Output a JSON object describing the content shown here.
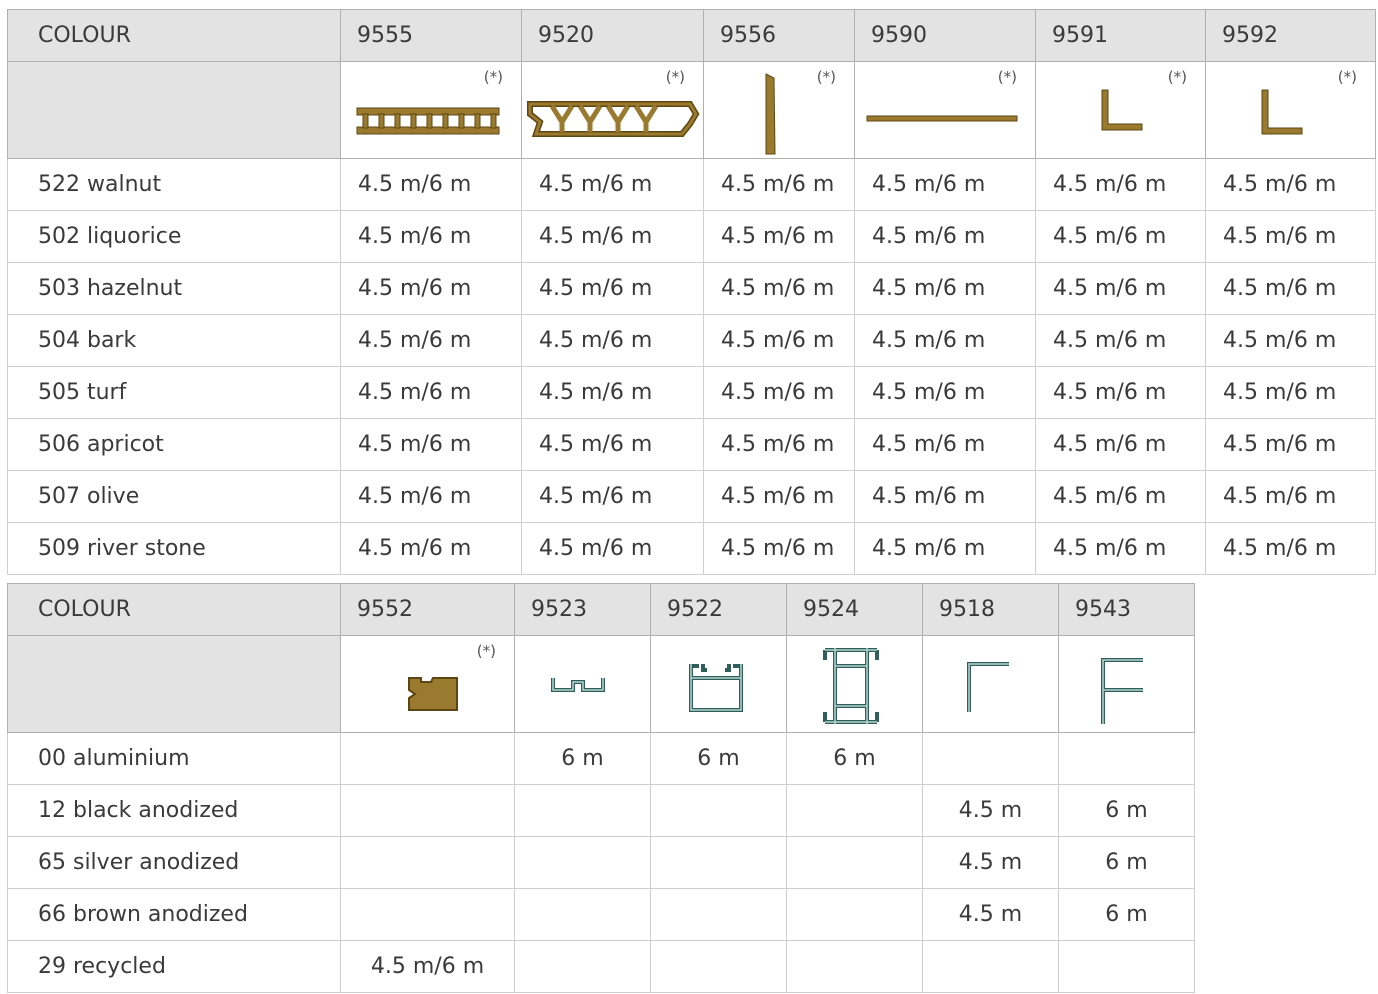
{
  "table1": {
    "header": [
      "COLOUR",
      "9555",
      "9520",
      "9556",
      "9590",
      "9591",
      "9592"
    ],
    "marker": "(*)",
    "profile_icons": [
      "deck-board-profile-icon",
      "deck-board-grooved-profile-icon",
      "vertical-strip-profile-icon",
      "flat-strip-profile-icon",
      "angle-profile-icon",
      "angle-profile-icon"
    ],
    "rows": [
      {
        "label": "522  walnut",
        "cells": [
          "4.5 m/6 m",
          "4.5 m/6 m",
          "4.5 m/6 m",
          "4.5 m/6 m",
          "4.5 m/6 m",
          "4.5 m/6 m"
        ]
      },
      {
        "label": "502  liquorice",
        "cells": [
          "4.5 m/6 m",
          "4.5 m/6 m",
          "4.5 m/6 m",
          "4.5 m/6 m",
          "4.5 m/6 m",
          "4.5 m/6 m"
        ]
      },
      {
        "label": "503  hazelnut",
        "cells": [
          "4.5 m/6 m",
          "4.5 m/6 m",
          "4.5 m/6 m",
          "4.5 m/6 m",
          "4.5 m/6 m",
          "4.5 m/6 m"
        ]
      },
      {
        "label": "504  bark",
        "cells": [
          "4.5 m/6 m",
          "4.5 m/6 m",
          "4.5 m/6 m",
          "4.5 m/6 m",
          "4.5 m/6 m",
          "4.5 m/6 m"
        ]
      },
      {
        "label": "505  turf",
        "cells": [
          "4.5 m/6 m",
          "4.5 m/6 m",
          "4.5 m/6 m",
          "4.5 m/6 m",
          "4.5 m/6 m",
          "4.5 m/6 m"
        ]
      },
      {
        "label": "506  apricot",
        "cells": [
          "4.5 m/6 m",
          "4.5 m/6 m",
          "4.5 m/6 m",
          "4.5 m/6 m",
          "4.5 m/6 m",
          "4.5 m/6 m"
        ]
      },
      {
        "label": "507  olive",
        "cells": [
          "4.5 m/6 m",
          "4.5 m/6 m",
          "4.5 m/6 m",
          "4.5 m/6 m",
          "4.5 m/6 m",
          "4.5 m/6 m"
        ]
      },
      {
        "label": "509  river stone",
        "cells": [
          "4.5 m/6 m",
          "4.5 m/6 m",
          "4.5 m/6 m",
          "4.5 m/6 m",
          "4.5 m/6 m",
          "4.5 m/6 m"
        ]
      }
    ]
  },
  "table2": {
    "header": [
      "COLOUR",
      "9552",
      "9523",
      "9522",
      "9524",
      "9518",
      "9543"
    ],
    "marker": "(*)",
    "profile_icons": [
      "end-cap-profile-icon",
      "channel-profile-icon",
      "box-profile-icon",
      "joist-profile-icon",
      "angle-profile-icon",
      "f-profile-icon"
    ],
    "rows": [
      {
        "label": "00  aluminium",
        "cells": [
          "",
          "6 m",
          "6 m",
          "6 m",
          "",
          ""
        ]
      },
      {
        "label": "12  black anodized",
        "cells": [
          "",
          "",
          "",
          "",
          "4.5 m",
          "6 m"
        ]
      },
      {
        "label": "65  silver anodized",
        "cells": [
          "",
          "",
          "",
          "",
          "4.5 m",
          "6 m"
        ]
      },
      {
        "label": "66  brown anodized",
        "cells": [
          "",
          "",
          "",
          "",
          "4.5 m",
          "6 m"
        ]
      },
      {
        "label": "29  recycled",
        "cells": [
          "4.5 m/6 m",
          "",
          "",
          "",
          "",
          ""
        ]
      }
    ]
  },
  "colors": {
    "wood": "#9a7a2e",
    "wood_dark": "#5e4612",
    "aluminium": "#5a8a86",
    "header_bg": "#e3e3e3",
    "border": "#b0b0b0"
  }
}
